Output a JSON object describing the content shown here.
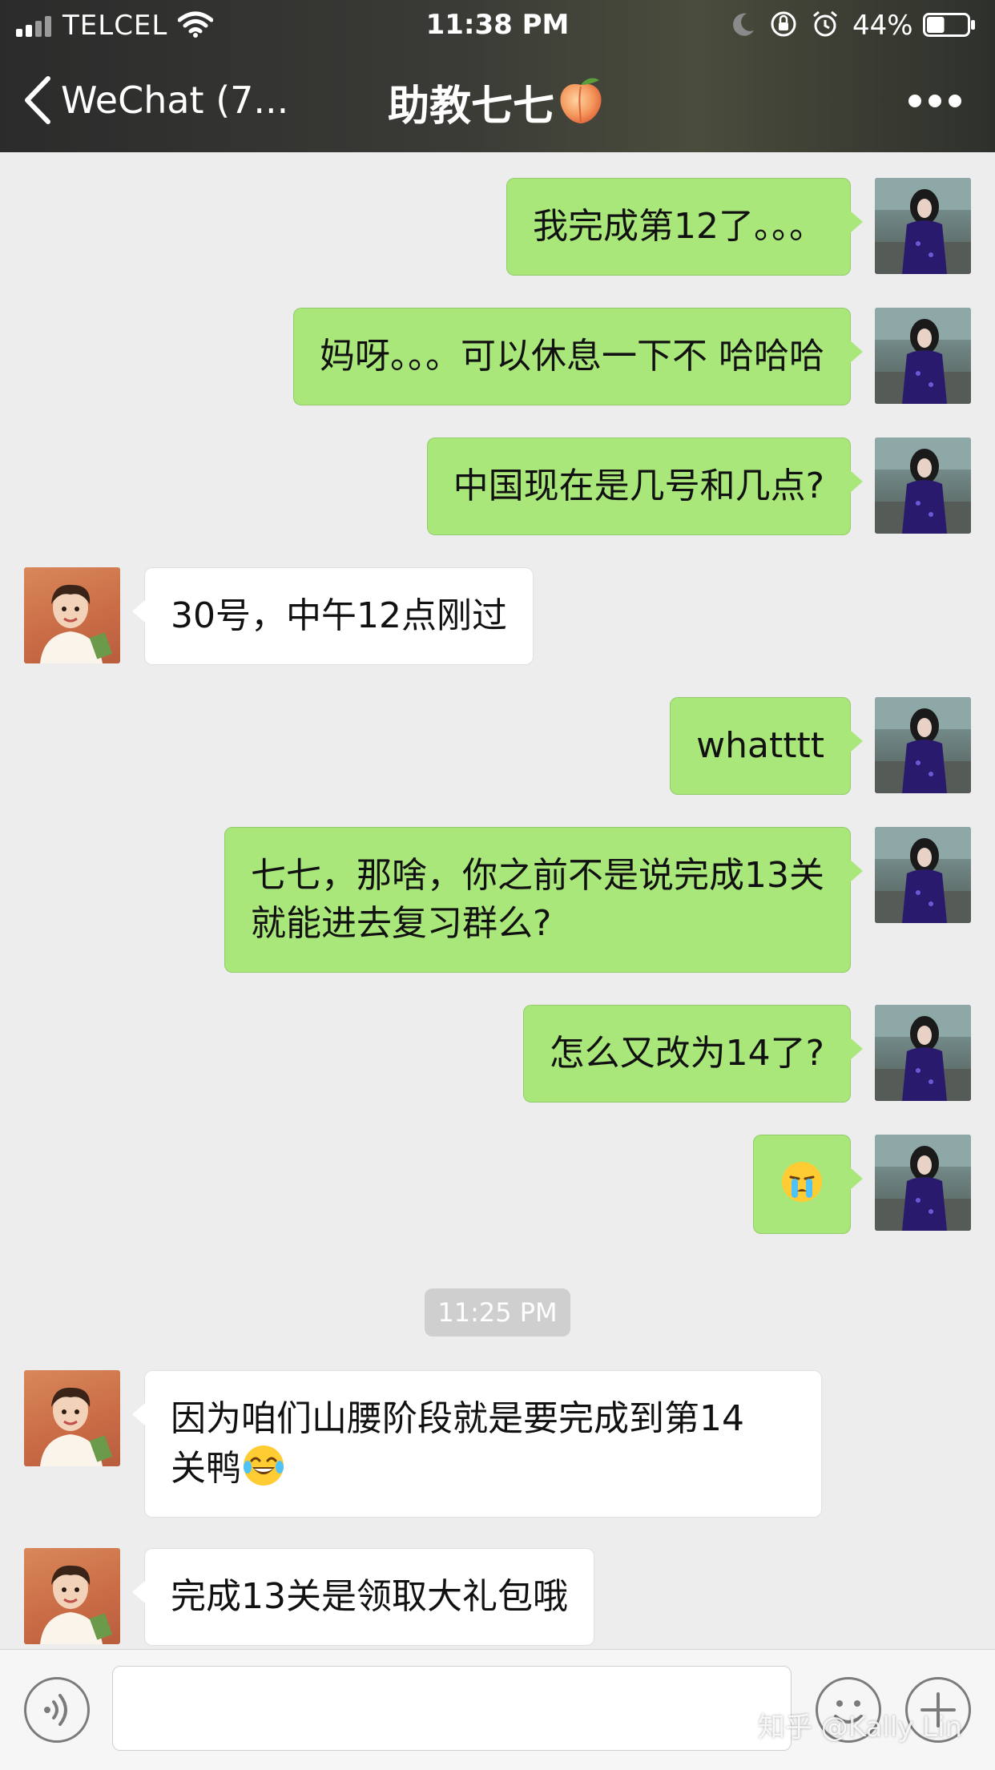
{
  "status_bar": {
    "carrier": "TELCEL",
    "time": "11:38 PM",
    "battery_percent": "44%",
    "battery_level": 0.44,
    "icons": [
      "signal-icon",
      "wifi-icon",
      "moon-icon",
      "orientation-lock-icon",
      "alarm-icon",
      "battery-icon"
    ]
  },
  "nav": {
    "back_label": "WeChat (7...",
    "title": "助教七七",
    "title_emoji": "peach-emoji",
    "more_icon": "more-icon"
  },
  "messages": [
    {
      "sender": "me",
      "text": "我完成第12了。。。"
    },
    {
      "sender": "me",
      "text": "妈呀。。。可以休息一下不 哈哈哈"
    },
    {
      "sender": "me",
      "text": "中国现在是几号和几点?"
    },
    {
      "sender": "them",
      "text": "30号，中午12点刚过"
    },
    {
      "sender": "me",
      "text": "whatttt"
    },
    {
      "sender": "me",
      "text_line1": "七七，那啥，你之前不是说完成13关",
      "text_line2": "就能进去复习群么?"
    },
    {
      "sender": "me",
      "text": "怎么又改为14了?"
    },
    {
      "sender": "me",
      "emoji": "crying-emoji"
    },
    {
      "sender": "them",
      "text_line1": "因为咱们山腰阶段就是要完成到第14",
      "text_line2": "关鸭",
      "emoji": "tears-of-joy-emoji"
    },
    {
      "sender": "them",
      "text": "完成13关是领取大礼包哦"
    }
  ],
  "timestamp_divider": "11:25 PM",
  "input_bar": {
    "placeholder": "",
    "voice_icon": "voice-icon",
    "emoji_icon": "emoji-icon",
    "plus_icon": "plus-icon"
  },
  "watermark": "知乎 @Kally Lin",
  "colors": {
    "my_bubble": "#a9e77a",
    "their_bubble": "#ffffff",
    "chat_background": "#ededed",
    "header_background": "#2e2e2e"
  }
}
